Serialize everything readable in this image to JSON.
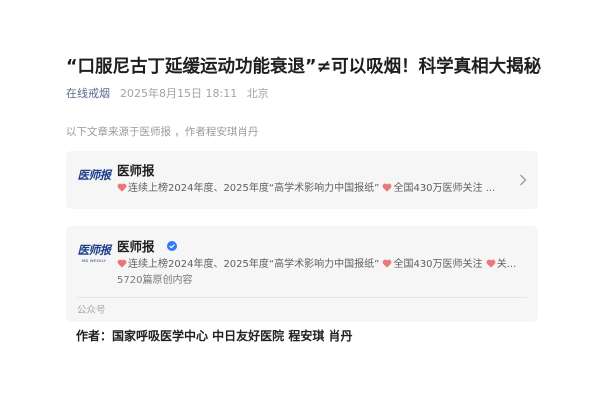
{
  "article": {
    "title": "“口服尼古丁延缓运动功能衰退”≠可以吸烟！科学真相大揭秘",
    "account_link": "在线戒烟",
    "date": "2025年8月15日 18:11",
    "location": "北京",
    "source_note": "以下文章来源于医师报 ，作者程安琪肖丹"
  },
  "source_card": {
    "logo_text": "医师报",
    "name": "医师报",
    "desc_segments": [
      "连续上榜2024年度、2025年度“高学术影响力中国报纸”",
      "全国430万医师关注",
      "..."
    ]
  },
  "profile_card": {
    "logo_text": "医师报",
    "logo_subtext": "MD WEEKLY",
    "name": "医师报",
    "desc_segments": [
      "连续上榜2024年度、2025年度“高学术影响力中国报纸”",
      "全国430万医师关注",
      "关..."
    ],
    "original_count": "5720篇原创内容",
    "type_label": "公众号"
  },
  "authors_line": "作者：国家呼吸医学中心 中日友好医院 程安琪 肖丹",
  "colors": {
    "link": "#596a8d",
    "heart": "#e8787a",
    "verified": "#2f7bf5",
    "logo": "#1d3f8a",
    "card_bg": "#f6f6f6"
  },
  "icons": {
    "heart": "heart-icon",
    "verified": "verified-check-icon",
    "chevron": "chevron-right-icon"
  }
}
